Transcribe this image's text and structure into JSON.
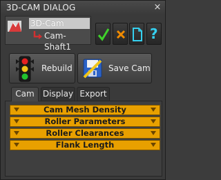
{
  "window": {
    "title": "3D-CAM DIALOG",
    "close_label": "×"
  },
  "tree": {
    "root_label": "3D-Cam",
    "child_label": "Cam-Shaft1"
  },
  "toolbar": {
    "icons": [
      "check-icon",
      "x-icon",
      "new-document-icon",
      "help-icon"
    ],
    "help_label": "?"
  },
  "buttons": {
    "rebuild_label": "Rebuild",
    "save_cam_label": "Save Cam"
  },
  "tabs": [
    {
      "label": "Cam"
    },
    {
      "label": "Display"
    },
    {
      "label": "Export"
    }
  ],
  "rollouts": [
    {
      "label": "Cam Mesh Density"
    },
    {
      "label": "Roller Parameters"
    },
    {
      "label": "Roller Clearances"
    },
    {
      "label": "Flank Length"
    }
  ],
  "colors": {
    "rollout_bg": "#e8a000",
    "check_green": "#3fd12b",
    "x_orange": "#f08a00",
    "doc_cyan": "#35d0f0",
    "help_cyan": "#35d0f0"
  }
}
